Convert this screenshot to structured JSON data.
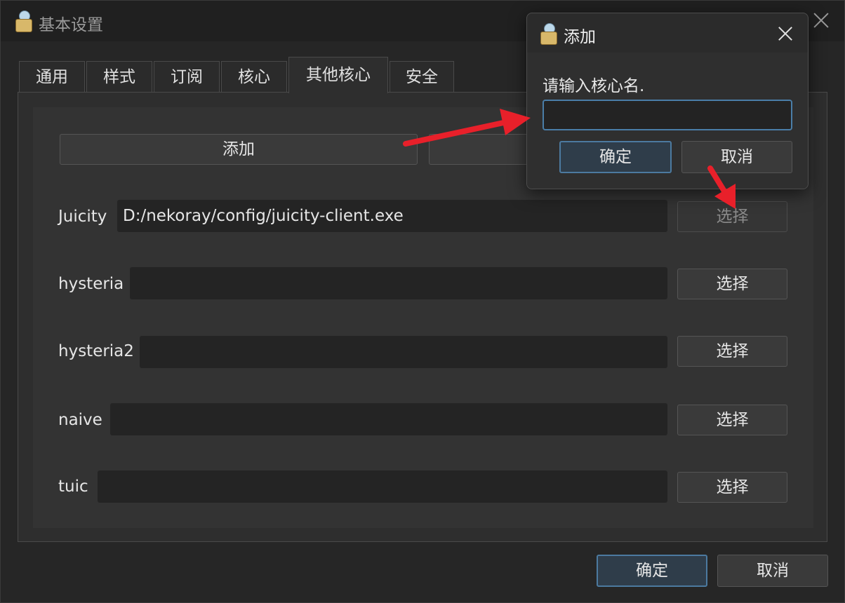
{
  "window": {
    "title": "基本设置"
  },
  "tabs": [
    {
      "label": "通用",
      "active": false
    },
    {
      "label": "样式",
      "active": false
    },
    {
      "label": "订阅",
      "active": false
    },
    {
      "label": "核心",
      "active": false
    },
    {
      "label": "其他核心",
      "active": true
    },
    {
      "label": "安全",
      "active": false
    }
  ],
  "panel": {
    "add_button": "添加",
    "cores": [
      {
        "name": "Juicity",
        "path": "D:/nekoray/config/juicity-client.exe",
        "select_label": "选择",
        "select_enabled": false
      },
      {
        "name": "hysteria",
        "path": "",
        "select_label": "选择",
        "select_enabled": true
      },
      {
        "name": "hysteria2",
        "path": "",
        "select_label": "选择",
        "select_enabled": true
      },
      {
        "name": "naive",
        "path": "",
        "select_label": "选择",
        "select_enabled": true
      },
      {
        "name": "tuic",
        "path": "",
        "select_label": "选择",
        "select_enabled": true
      }
    ]
  },
  "footer": {
    "ok_label": "确定",
    "cancel_label": "取消"
  },
  "dialog": {
    "title": "添加",
    "prompt": "请输入核心名.",
    "input_value": "",
    "ok_label": "确定",
    "cancel_label": "取消"
  },
  "annotations": {
    "arrow_color": "#e8202a"
  },
  "colors": {
    "accent_border": "#4c7aa0",
    "background": "#262626"
  }
}
